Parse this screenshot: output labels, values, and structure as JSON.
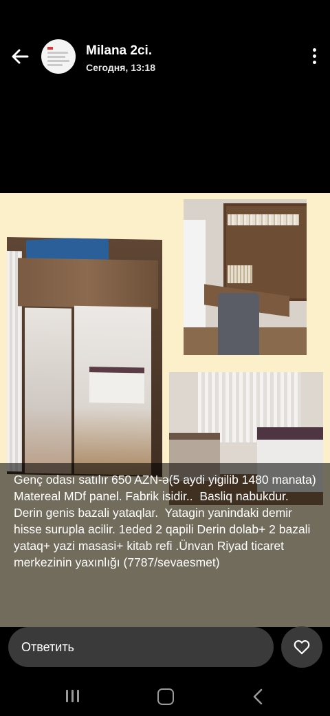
{
  "header": {
    "name": "Milana 2ci.",
    "timestamp": "Сегодня, 13:18"
  },
  "story": {
    "caption": "Genç odası satılır 650 AZN-ə(5 aydi yigilib 1480 manata)\nMatereal MDf panel. Fabrik isidir..  Basliq nabukdur. Derin genis bazali yataqlar.  Yatagin yanindaki demir hisse surupla acilir. 1eded 2 qapili Derin dolab+ 2 bazali yataq+ yazi masasi+ kitab refi .Ünvan Riyad ticaret merkezinin yaxınlığı (7787/sevaesmet)",
    "background_color": "#fbf0c9"
  },
  "footer": {
    "reply_placeholder": "Ответить"
  },
  "icons": {
    "back": "arrow-left-icon",
    "menu": "more-vertical-icon",
    "like": "heart-icon",
    "nav_recent": "recent-apps-icon",
    "nav_home": "home-icon",
    "nav_back": "chevron-left-icon"
  }
}
